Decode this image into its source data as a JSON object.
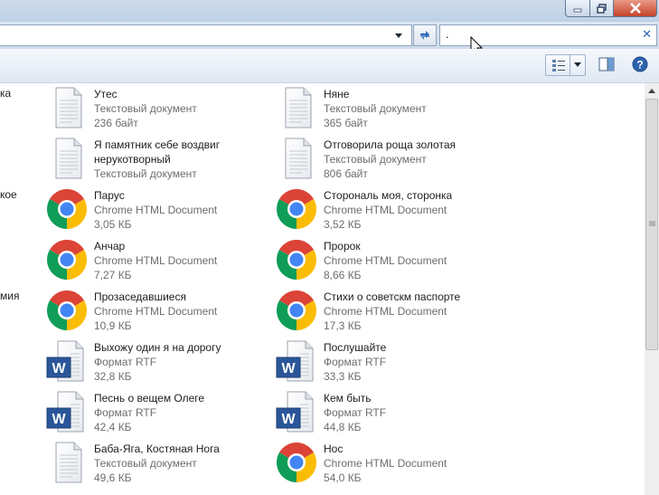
{
  "window": {
    "title": ""
  },
  "address": {
    "value": ""
  },
  "search": {
    "value": ".",
    "clear_icon": "close-icon"
  },
  "toolbar": {
    "view_icon": "details-view-icon",
    "pane_icon": "preview-pane-icon",
    "help_icon": "help-icon"
  },
  "left_cut": [
    "ка",
    "кое",
    "мия"
  ],
  "files": [
    {
      "name": "Утес",
      "type": "Текстовый документ",
      "size": "236 байт",
      "icon": "txt"
    },
    {
      "name": "Няне",
      "type": "Текстовый документ",
      "size": "365 байт",
      "icon": "txt"
    },
    {
      "name": "Я памятник себе воздвиг нерукотворный",
      "type": "Текстовый документ",
      "size": "",
      "icon": "txt"
    },
    {
      "name": "Отговорила роща золотая",
      "type": "Текстовый документ",
      "size": "806 байт",
      "icon": "txt"
    },
    {
      "name": "Парус",
      "type": "Chrome HTML Document",
      "size": "3,05 КБ",
      "icon": "chrome"
    },
    {
      "name": "Сторональ моя, сторонка",
      "type": "Chrome HTML Document",
      "size": "3,52 КБ",
      "icon": "chrome"
    },
    {
      "name": "Анчар",
      "type": "Chrome HTML Document",
      "size": "7,27 КБ",
      "icon": "chrome"
    },
    {
      "name": "Пророк",
      "type": "Chrome HTML Document",
      "size": "8,66 КБ",
      "icon": "chrome"
    },
    {
      "name": "Прозаседавшиеся",
      "type": "Chrome HTML Document",
      "size": "10,9 КБ",
      "icon": "chrome"
    },
    {
      "name": "Стихи о советскм паспорте",
      "type": "Chrome HTML Document",
      "size": "17,3 КБ",
      "icon": "chrome"
    },
    {
      "name": "Выхожу один я на дорогу",
      "type": "Формат RTF",
      "size": "32,8 КБ",
      "icon": "rtf"
    },
    {
      "name": "Послушайте",
      "type": "Формат RTF",
      "size": "33,3 КБ",
      "icon": "rtf"
    },
    {
      "name": "Песнь о вещем Олеге",
      "type": "Формат RTF",
      "size": "42,4 КБ",
      "icon": "rtf"
    },
    {
      "name": "Кем быть",
      "type": "Формат RTF",
      "size": "44,8 КБ",
      "icon": "rtf"
    },
    {
      "name": "Баба-Яга, Костяная Нога",
      "type": "Текстовый документ",
      "size": "49,6 КБ",
      "icon": "txt"
    },
    {
      "name": "Нос",
      "type": "Chrome HTML Document",
      "size": "54,0 КБ",
      "icon": "chrome"
    }
  ]
}
